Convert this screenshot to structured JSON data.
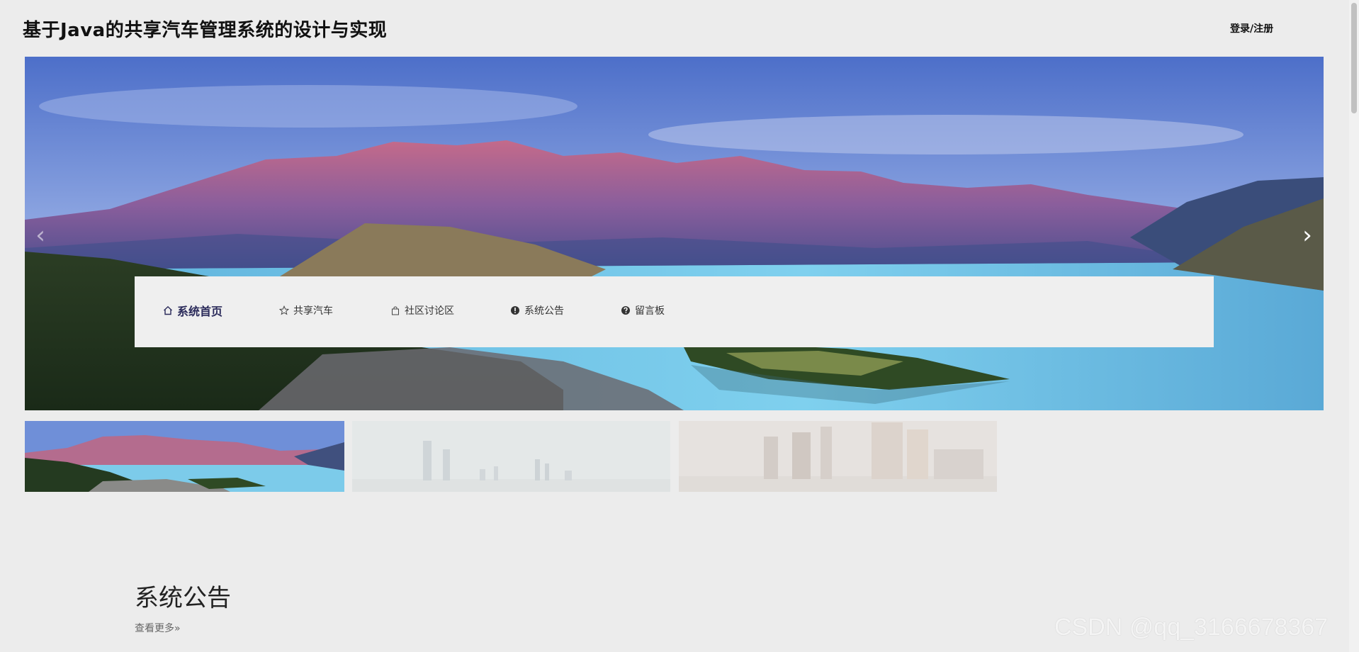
{
  "header": {
    "site_title": "基于Java的共享汽车管理系统的设计与实现",
    "login_label": "登录/注册"
  },
  "banner": {
    "prev_icon": "chevron-left-icon",
    "next_icon": "chevron-right-icon",
    "prev_glyph": "‹",
    "next_glyph": "›"
  },
  "nav": {
    "items": [
      {
        "label": "系统首页",
        "icon": "home-icon"
      },
      {
        "label": "共享汽车",
        "icon": "star-icon"
      },
      {
        "label": "社区讨论区",
        "icon": "bag-icon"
      },
      {
        "label": "系统公告",
        "icon": "exclamation-circle-icon"
      },
      {
        "label": "留言板",
        "icon": "question-circle-icon"
      }
    ]
  },
  "notice": {
    "title": "系统公告",
    "more_label": "查看更多»"
  },
  "watermark": "CSDN @qq_3166678367",
  "colors": {
    "background": "#ececec",
    "nav_bg": "#efefef",
    "nav_active": "#2a2a5a"
  }
}
